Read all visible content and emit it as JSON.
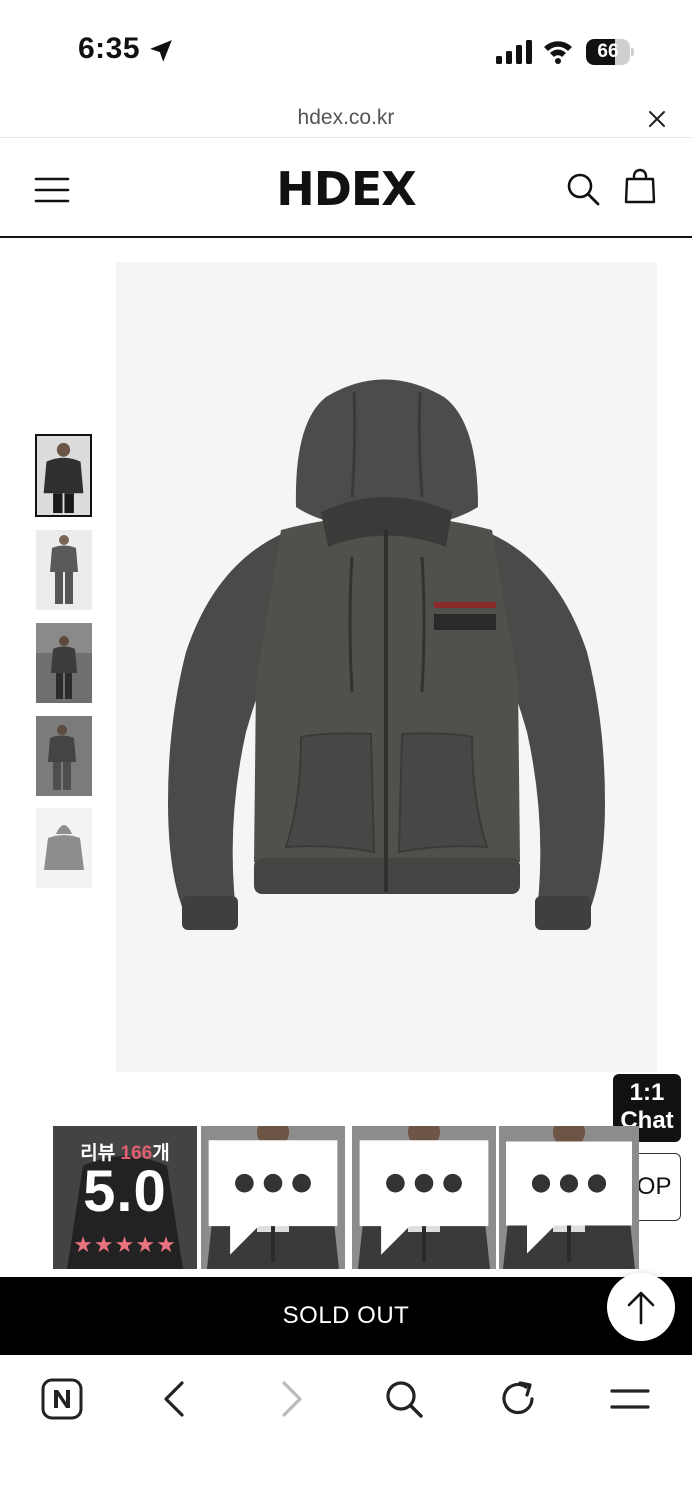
{
  "status_bar": {
    "time": "6:35",
    "battery": "66",
    "battery_level": 0.66
  },
  "url_bar": {
    "url": "hdex.co.kr"
  },
  "header": {
    "logo": "HDEX"
  },
  "side_buttons": {
    "chat_line1": "1:1",
    "chat_line2": "Chat",
    "top_label": "TOP"
  },
  "review": {
    "label_prefix": "리뷰 ",
    "count": "166",
    "label_suffix": "개",
    "score": "5.0",
    "stars": "★★★★★",
    "rating": 5
  },
  "action": {
    "sold_out_label": "SOLD OUT"
  },
  "icons": {
    "status": [
      "location-arrow-icon",
      "signal-icon",
      "wifi-icon",
      "battery-icon"
    ],
    "header": [
      "hamburger-menu-icon",
      "search-icon",
      "shopping-bag-icon"
    ],
    "toolbar": [
      "naver-home-icon",
      "back-icon",
      "forward-icon",
      "search-icon",
      "refresh-icon",
      "menu-icon"
    ]
  },
  "colors": {
    "accent_pink": "#e8737f",
    "sold_out_bg": "#000000"
  }
}
